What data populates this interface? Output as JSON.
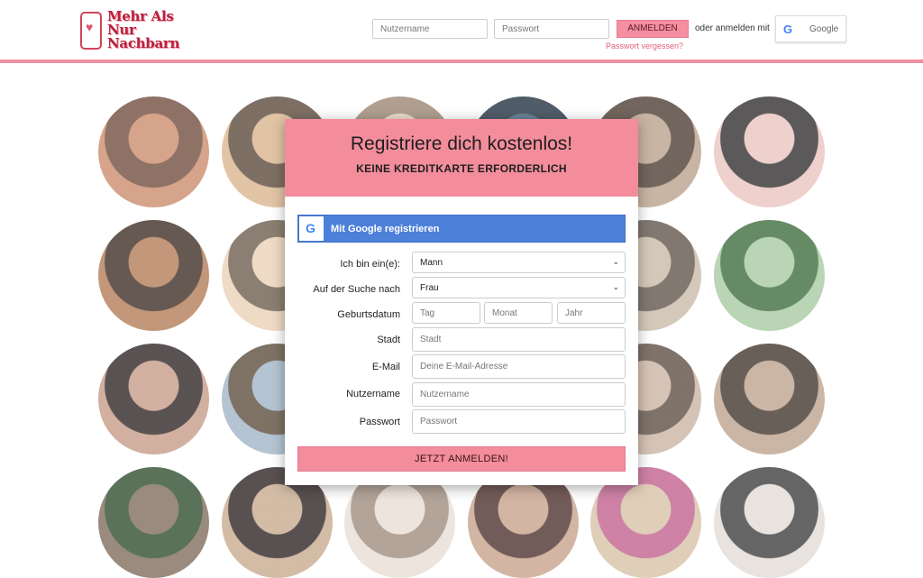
{
  "header": {
    "logo": {
      "line1": "Mehr Als",
      "line2": "Nur",
      "line3": "Nachbarn"
    },
    "username_placeholder": "Nutzername",
    "password_placeholder": "Passwort",
    "login_label": "ANMELDEN",
    "or_text": "oder anmelden mit",
    "google_label": "Google",
    "forgot_label": "Passwort vergessen?"
  },
  "signup": {
    "title": "Registriere dich kostenlos!",
    "subtitle": "KEINE KREDITKARTE ERFORDERLICH",
    "google_label": "Mit Google registrieren",
    "fields": {
      "gender_label": "Ich bin ein(e):",
      "gender_value": "Mann",
      "seeking_label": "Auf der Suche nach",
      "seeking_value": "Frau",
      "birthdate_label": "Geburtsdatum",
      "day_placeholder": "Tag",
      "month_placeholder": "Monat",
      "year_placeholder": "Jahr",
      "city_label": "Stadt",
      "city_placeholder": "Stadt",
      "email_label": "E-Mail",
      "email_placeholder": "Deine E-Mail-Adresse",
      "username_label": "Nutzername",
      "username_placeholder": "Nutzername",
      "password_label": "Passwort",
      "password_placeholder": "Passwort"
    },
    "submit_label": "JETZT ANMELDEN!"
  },
  "colors": {
    "accent": "#f38d9c",
    "google_blue": "#4d80d8",
    "brand_red": "#b8213e"
  }
}
